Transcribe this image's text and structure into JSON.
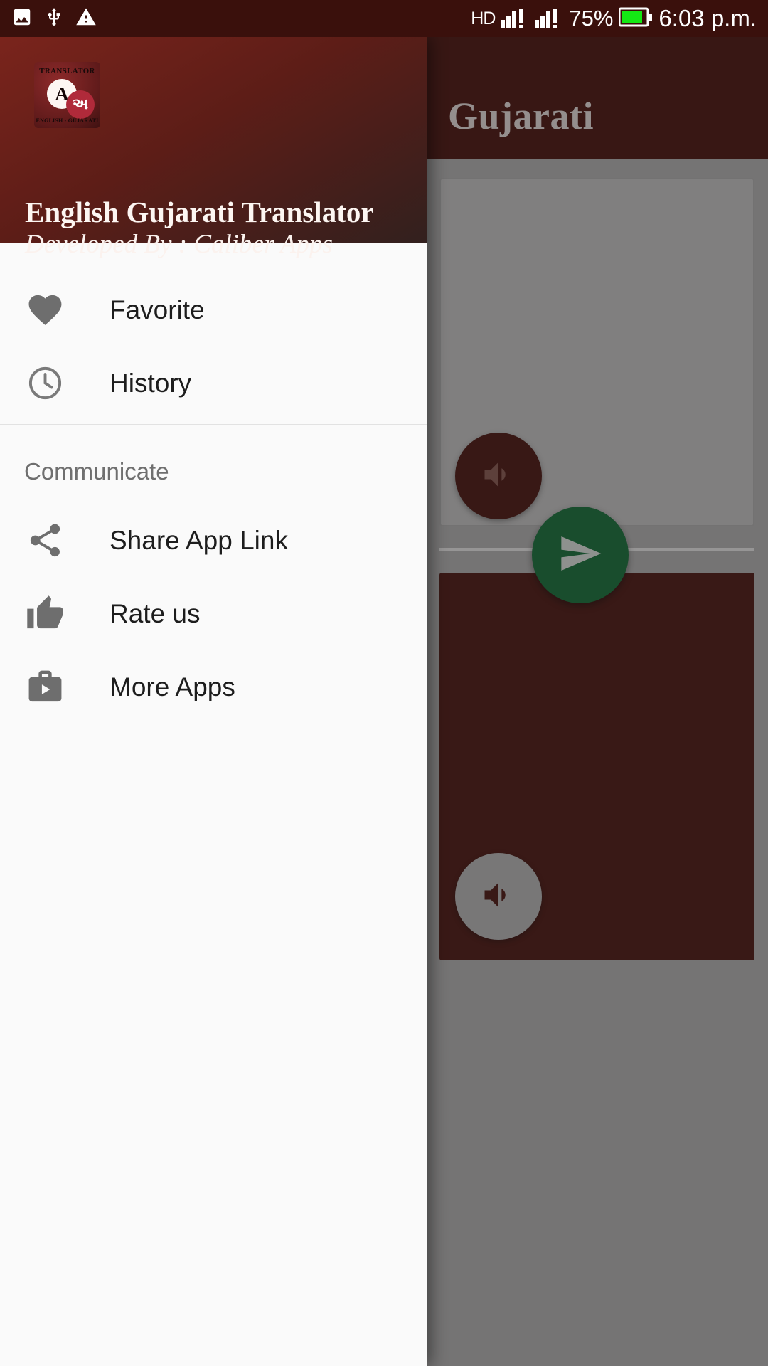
{
  "status_bar": {
    "left_icons": [
      "image-icon",
      "usb-icon",
      "warning-icon"
    ],
    "network_label": "HD",
    "signal_icons": [
      "signal-bars-icon",
      "signal-bars-icon"
    ],
    "battery_percent": "75%",
    "battery_icon": "battery-icon",
    "time": "6:03 p.m.",
    "background_color": "#3a100c"
  },
  "background_app": {
    "title": "Gujarati",
    "appbar_color": "#4a140f",
    "speak_input_button": "volume-up-icon",
    "send_button": "send-icon",
    "speak_result_button": "volume-up-icon",
    "send_button_color": "#15713a",
    "result_card_color": "#4c1712"
  },
  "drawer": {
    "logo": {
      "top_text": "TRANSLATOR",
      "letter_english": "A",
      "letter_gujarati": "અ",
      "bottom_text": "ENGLISH - GUJARATI"
    },
    "title": "English Gujarati Translator",
    "subtitle": "Developed By : Caliber Apps",
    "primary_items": [
      {
        "label": "Favorite",
        "icon": "heart-icon"
      },
      {
        "label": "History",
        "icon": "clock-icon"
      }
    ],
    "section_label": "Communicate",
    "communicate_items": [
      {
        "label": "Share App Link",
        "icon": "share-icon"
      },
      {
        "label": "Rate us",
        "icon": "thumb-up-icon"
      },
      {
        "label": "More Apps",
        "icon": "more-apps-icon"
      }
    ]
  }
}
